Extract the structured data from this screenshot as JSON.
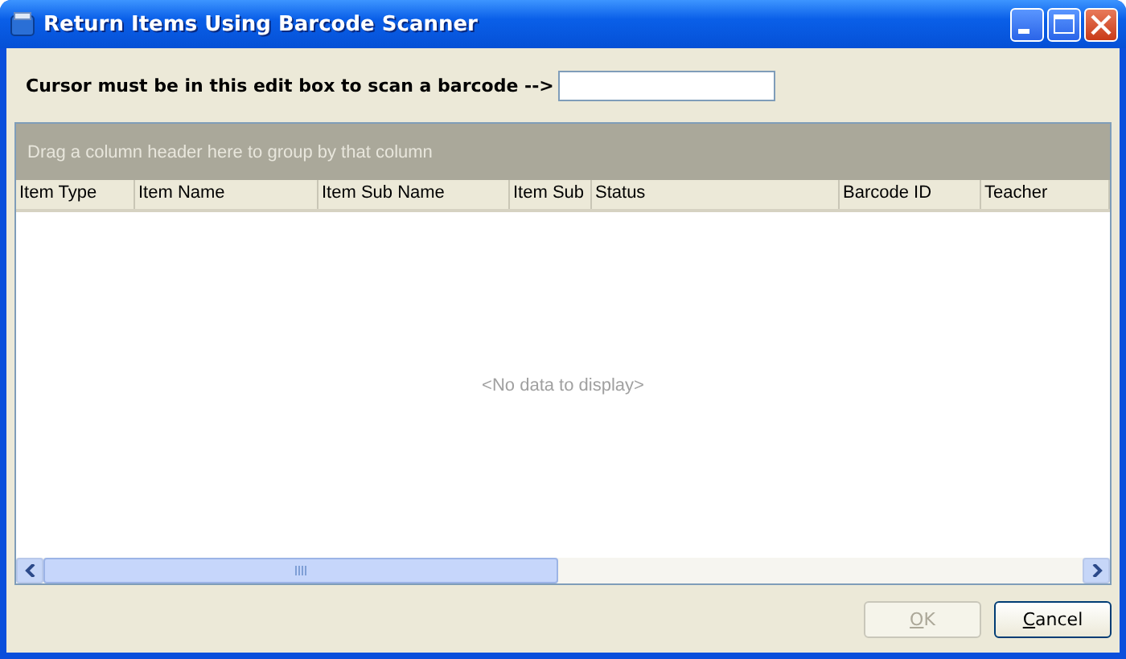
{
  "window": {
    "title": "Return Items Using Barcode Scanner"
  },
  "scan": {
    "label": "Cursor must be in this edit box to scan a barcode -->"
  },
  "grid": {
    "group_panel": "Drag a column header here to group by that column",
    "columns": [
      "Item Type",
      "Item Name",
      "Item Sub Name",
      "Item Sub",
      "Status",
      "Barcode ID",
      "Teacher"
    ],
    "empty_text": "<No data to display>"
  },
  "buttons": [
    {
      "label": "OK",
      "disabled": true
    },
    {
      "label": "Cancel",
      "disabled": false
    }
  ]
}
